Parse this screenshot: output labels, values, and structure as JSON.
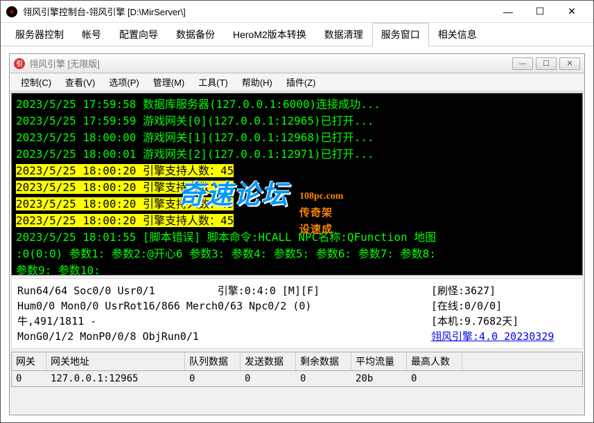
{
  "outer": {
    "title": "翎风引擎控制台-翎风引擎 [D:\\MirServer\\]",
    "btns": {
      "min": "—",
      "max": "☐",
      "close": "✕"
    }
  },
  "tabs": [
    "服务器控制",
    "帐号",
    "配置向导",
    "数据备份",
    "HeroM2版本转换",
    "数据清理",
    "服务窗口",
    "相关信息"
  ],
  "activeTab": 6,
  "inner": {
    "title": "翎风引擎 [无限版]",
    "btns": {
      "min": "—",
      "max": "☐",
      "close": "✕"
    },
    "menu": [
      "控制(C)",
      "查看(V)",
      "选项(P)",
      "管理(M)",
      "工具(T)",
      "帮助(H)",
      "插件(Z)"
    ]
  },
  "log": [
    {
      "t": "green",
      "text": "2023/5/25 17:59:58 数据库服务器(127.0.0.1:6000)连接成功..."
    },
    {
      "t": "green",
      "text": "2023/5/25 17:59:59 游戏网关[0](127.0.0.1:12965)已打开..."
    },
    {
      "t": "green",
      "text": "2023/5/25 18:00:00 游戏网关[1](127.0.0.1:12968)已打开..."
    },
    {
      "t": "green",
      "text": "2023/5/25 18:00:01 游戏网关[2](127.0.0.1:12971)已打开..."
    },
    {
      "t": "hl",
      "text": "2023/5/25 18:00:20 引擎支持人数：45"
    },
    {
      "t": "hl",
      "text": "2023/5/25 18:00:20 引擎支持人数：45"
    },
    {
      "t": "hl",
      "text": "2023/5/25 18:00:20 引擎支持人数：45"
    },
    {
      "t": "hl",
      "text": "2023/5/25 18:00:20 引擎支持人数：45"
    },
    {
      "t": "green",
      "text": "2023/5/25 18:01:55 [脚本错误]  脚本命令:HCALL NPC名称:QFunction 地图:0(0:0) 参数1: 参数2:@开心6 参数3: 参数4: 参数5: 参数6: 参数7: 参数8: 参数9: 参数10:"
    }
  ],
  "watermark": {
    "main": "奇速论坛",
    "url": "108pc.com",
    "sub": "传奇架设速成"
  },
  "status": {
    "l1l": "Run64/64 Soc0/0 Usr0/1",
    "l1m": "引擎:0:4:0 [M][F]",
    "l1r": "[刷怪:3627]",
    "l2l": "Hum0/0 Mon0/0 UsrRot16/866 Merch0/63 Npc0/2 (0)",
    "l2r": "[在线:0/0/0]",
    "l3l": "牛,491/1811 -",
    "l3r": "[本机:9.7682天]",
    "l4l": "MonG0/1/2 MonP0/0/8 ObjRun0/1",
    "l4r": "翎风引擎:4.0 20230329"
  },
  "grid": {
    "headers": [
      "网关",
      "网关地址",
      "队列数据",
      "发送数据",
      "剩余数据",
      "平均流量",
      "最高人数"
    ],
    "row": [
      "0",
      "127.0.0.1:12965",
      "0",
      "0",
      "0",
      "20b",
      "0"
    ]
  }
}
